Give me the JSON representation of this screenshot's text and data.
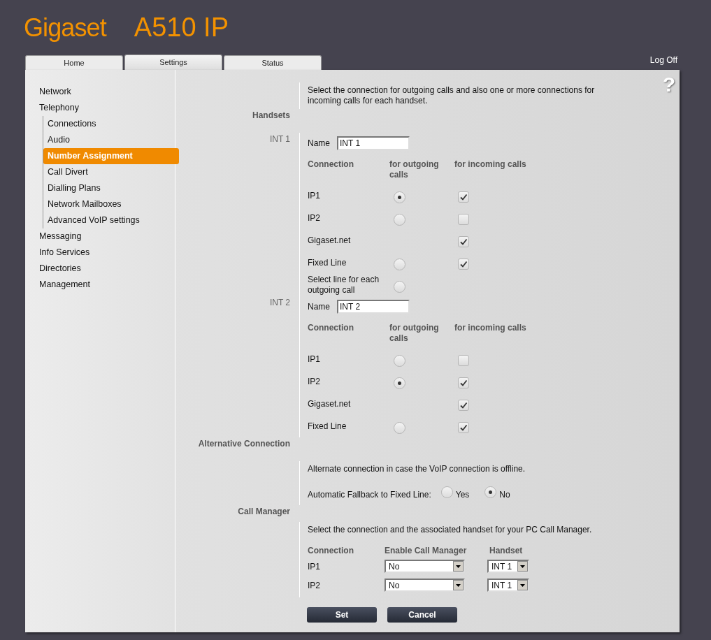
{
  "header": {
    "logo": "Gigaset",
    "model": "A510 IP"
  },
  "tabs": [
    {
      "label": "Home",
      "selected": false
    },
    {
      "label": "Settings",
      "selected": true
    },
    {
      "label": "Status",
      "selected": false
    }
  ],
  "log_off": "Log Off",
  "help": "?",
  "sidebar": {
    "items": [
      {
        "label": "Network",
        "selected": false
      },
      {
        "label": "Telephony",
        "selected": false,
        "children": [
          {
            "label": "Connections",
            "selected": false
          },
          {
            "label": "Audio",
            "selected": false
          },
          {
            "label": "Number Assignment",
            "selected": true
          },
          {
            "label": "Call Divert",
            "selected": false
          },
          {
            "label": "Dialling Plans",
            "selected": false
          },
          {
            "label": "Network Mailboxes",
            "selected": false
          },
          {
            "label": "Advanced VoIP settings",
            "selected": false
          }
        ]
      },
      {
        "label": "Messaging",
        "selected": false
      },
      {
        "label": "Info Services",
        "selected": false
      },
      {
        "label": "Directories",
        "selected": false
      },
      {
        "label": "Management",
        "selected": false
      }
    ]
  },
  "intro": "Select the connection for outgoing calls and also one or more connections for incoming calls for each handset.",
  "handsets": {
    "heading": "Handsets",
    "items": [
      {
        "label": "INT 1",
        "name_label": "Name",
        "name_value": "INT 1",
        "columns": [
          "Connection",
          "for outgoing calls",
          "for incoming calls"
        ],
        "rows": [
          {
            "connection": "IP1",
            "outgoing": true,
            "incoming": true
          },
          {
            "connection": "IP2",
            "outgoing": false,
            "incoming": false
          },
          {
            "connection": "Gigaset.net",
            "incoming": true
          },
          {
            "connection": "Fixed Line",
            "outgoing": false,
            "incoming": true
          },
          {
            "connection": "Select line for each outgoing call",
            "outgoing": false
          }
        ]
      },
      {
        "label": "INT 2",
        "name_label": "Name",
        "name_value": "INT 2",
        "columns": [
          "Connection",
          "for outgoing calls",
          "for incoming calls"
        ],
        "rows": [
          {
            "connection": "IP1",
            "outgoing": false,
            "incoming": false
          },
          {
            "connection": "IP2",
            "outgoing": true,
            "incoming": true
          },
          {
            "connection": "Gigaset.net",
            "incoming": true
          },
          {
            "connection": "Fixed Line",
            "outgoing": false,
            "incoming": true
          }
        ]
      }
    ]
  },
  "alternative": {
    "heading": "Alternative Connection",
    "text": "Alternate connection in case the VoIP connection is offline.",
    "fallback_label": "Automatic Fallback to Fixed Line:",
    "options": [
      {
        "label": "Yes",
        "selected": false
      },
      {
        "label": "No",
        "selected": true
      }
    ]
  },
  "call_manager": {
    "heading": "Call Manager",
    "text": "Select the connection and the associated handset for your PC Call Manager.",
    "columns": [
      "Connection",
      "Enable Call Manager",
      "Handset"
    ],
    "rows": [
      {
        "connection": "IP1",
        "enable": "No",
        "handset": "INT 1"
      },
      {
        "connection": "IP2",
        "enable": "No",
        "handset": "INT 1"
      }
    ]
  },
  "buttons": [
    {
      "label": "Set"
    },
    {
      "label": "Cancel"
    }
  ]
}
